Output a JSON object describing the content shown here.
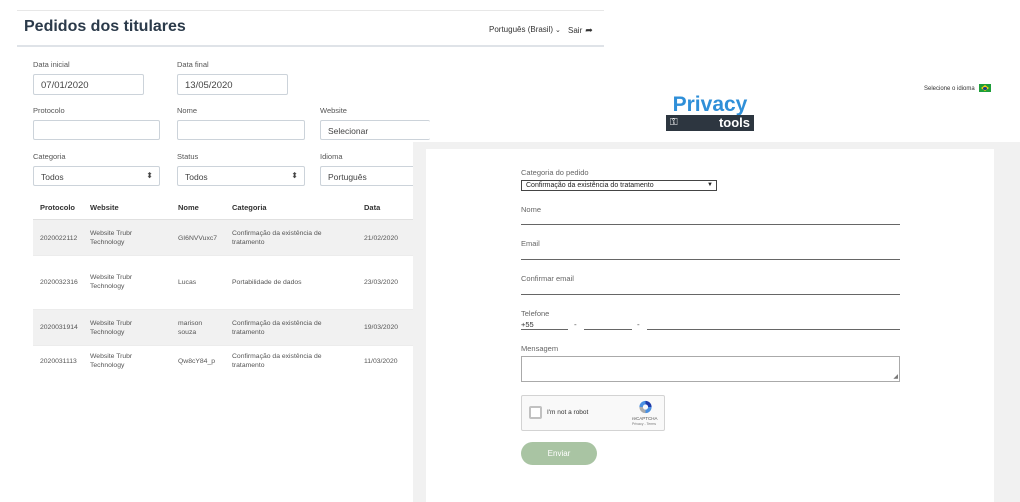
{
  "admin": {
    "title": "Pedidos dos titulares",
    "language_selector": "Português (Brasil)",
    "logout_label": "Sair",
    "filters": {
      "start_date": {
        "label": "Data inicial",
        "value": "07/01/2020"
      },
      "end_date": {
        "label": "Data final",
        "value": "13/05/2020"
      },
      "protocol": {
        "label": "Protocolo",
        "value": ""
      },
      "name": {
        "label": "Nome",
        "value": ""
      },
      "website": {
        "label": "Website",
        "value": "Selecionar"
      },
      "category": {
        "label": "Categoria",
        "value": "Todos"
      },
      "status": {
        "label": "Status",
        "value": "Todos"
      },
      "language": {
        "label": "Idioma",
        "value": "Português"
      }
    },
    "table": {
      "headers": [
        "Protocolo",
        "Website",
        "Nome",
        "Categoria",
        "Data"
      ],
      "rows": [
        {
          "protocol": "2020022112",
          "website": "Website Trubr Technology",
          "name": "GI6NVVuxc7",
          "category": "Confirmação da existência de tratamento",
          "date": "21/02/2020"
        },
        {
          "protocol": "2020032316",
          "website": "Website Trubr Technology",
          "name": "Lucas",
          "category": "Portabilidade de dados",
          "date": "23/03/2020"
        },
        {
          "protocol": "2020031914",
          "website": "Website Trubr Technology",
          "name": "marison souza",
          "category": "Confirmação da existência de tratamento",
          "date": "19/03/2020"
        },
        {
          "protocol": "2020031113",
          "website": "Website Trubr Technology",
          "name": "Qw8cY84_p",
          "category": "Confirmação da existência de tratamento",
          "date": "11/03/2020"
        }
      ]
    }
  },
  "portal": {
    "logo_top": "Privacy",
    "logo_bottom": "tools",
    "select_language_label": "Selecione o idioma",
    "form": {
      "category_label": "Categoria do pedido",
      "category_value": "Confirmação da existência do tratamento",
      "name_label": "Nome",
      "email_label": "Email",
      "confirm_email_label": "Confirmar email",
      "phone_label": "Telefone",
      "phone_code": "+55",
      "phone_separator": "-",
      "message_label": "Mensagem",
      "captcha_text": "I'm not a robot",
      "captcha_brand": "reCAPTCHA",
      "captcha_terms": "Privacy - Terms",
      "submit_label": "Enviar"
    }
  },
  "colors": {
    "title": "#2b3a4a",
    "logo_blue": "#2f8fd8",
    "logo_dark": "#2d3640",
    "submit_green": "#a9c4a3",
    "flag_green": "#1e9e3a"
  }
}
